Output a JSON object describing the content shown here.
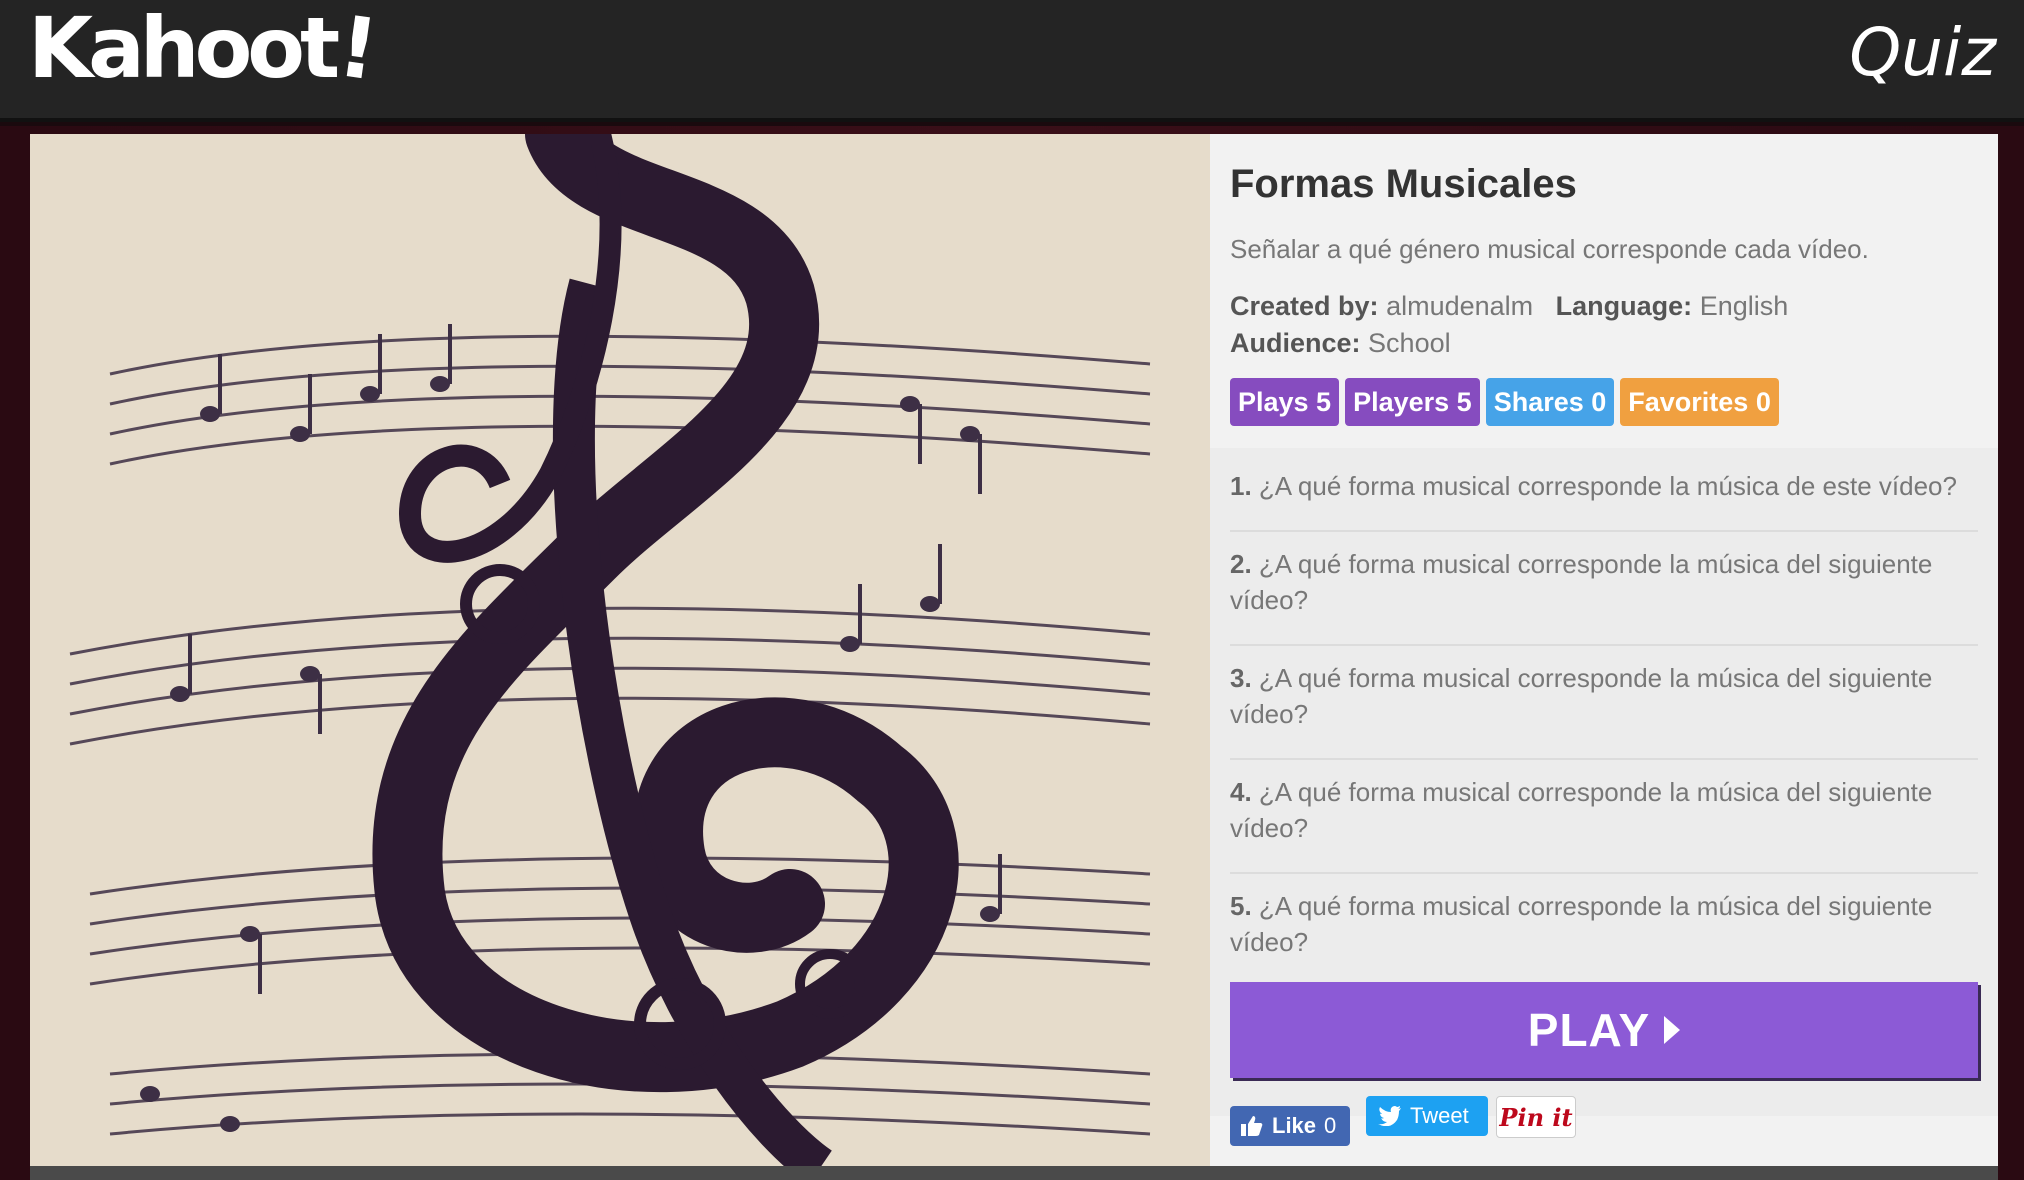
{
  "app": {
    "logo": "Kahoot",
    "logo_bang": "!",
    "section": "Quiz"
  },
  "quiz": {
    "title": "Formas Musicales",
    "description": "Señalar a qué género musical corresponde cada vídeo.",
    "created_by_label": "Created by:",
    "created_by": "almudenalm",
    "language_label": "Language:",
    "language": "English",
    "audience_label": "Audience:",
    "audience": "School"
  },
  "stats": {
    "plays": "Plays 5",
    "players": "Players 5",
    "shares": "Shares 0",
    "favorites": "Favorites 0"
  },
  "questions": [
    {
      "num": "1.",
      "text": "¿A qué forma musical corresponde la música de este vídeo?"
    },
    {
      "num": "2.",
      "text": "¿A qué forma musical corresponde la música del siguiente vídeo?"
    },
    {
      "num": "3.",
      "text": "¿A qué forma musical corresponde la música del siguiente vídeo?"
    },
    {
      "num": "4.",
      "text": "¿A qué forma musical corresponde la música del siguiente vídeo?"
    },
    {
      "num": "5.",
      "text": "¿A qué forma musical corresponde la música del siguiente vídeo?"
    }
  ],
  "play_button": "PLAY",
  "social": {
    "like": "Like",
    "like_count": "0",
    "tweet": "Tweet",
    "pin": "Pin it"
  },
  "colors": {
    "purple": "#864cbf",
    "blue": "#46a3e8",
    "orange": "#f0a040",
    "play": "#8c5ad6",
    "header": "#242424"
  },
  "icons": [
    "treble-clef-image",
    "play-triangle-icon",
    "thumbs-up-icon",
    "twitter-bird-icon"
  ]
}
